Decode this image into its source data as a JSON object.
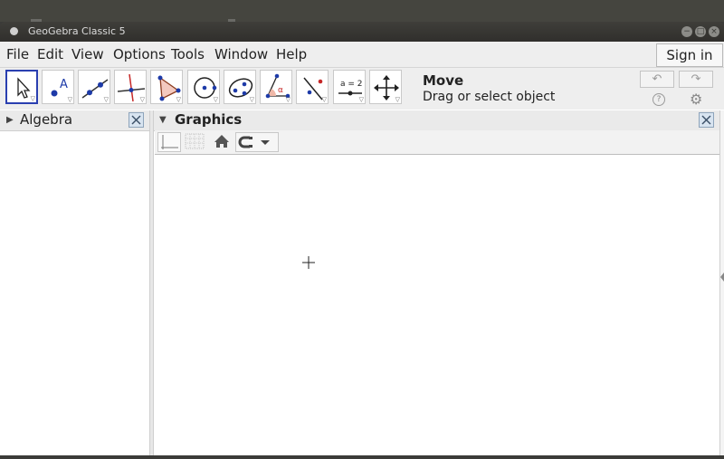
{
  "window": {
    "title": "GeoGebra Classic 5"
  },
  "menubar": {
    "items": [
      "File",
      "Edit",
      "View",
      "Options",
      "Tools",
      "Window",
      "Help"
    ],
    "sign_in": "Sign in"
  },
  "toolbar": {
    "tools": [
      {
        "name": "move-tool"
      },
      {
        "name": "point-tool"
      },
      {
        "name": "line-tool"
      },
      {
        "name": "perpendicular-line-tool"
      },
      {
        "name": "polygon-tool"
      },
      {
        "name": "circle-tool"
      },
      {
        "name": "ellipse-tool"
      },
      {
        "name": "angle-tool"
      },
      {
        "name": "reflect-tool"
      },
      {
        "name": "slider-tool"
      },
      {
        "name": "move-graphics-view-tool"
      }
    ],
    "point_label": "A",
    "angle_label": "α",
    "slider_label": "a = 2",
    "selected_tool_name": "Move",
    "selected_tool_help": "Drag or select object"
  },
  "algebra": {
    "title": "Algebra"
  },
  "graphics": {
    "title": "Graphics"
  }
}
